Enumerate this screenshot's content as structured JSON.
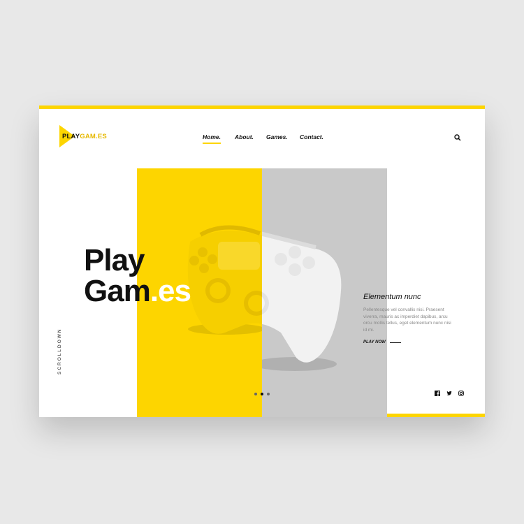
{
  "brand": {
    "logo_part1": "PLAY",
    "logo_part2": "GAM.ES",
    "accent": "#fdd500",
    "secondary": "#c9c9c9"
  },
  "nav": {
    "items": [
      "Home.",
      "About.",
      "Games.",
      "Contact."
    ],
    "active": "Home."
  },
  "hero": {
    "line1": "Play",
    "line2_main": "Gam",
    "line2_accent": ".es"
  },
  "side": {
    "title": "Elementum nunc",
    "body": "Pellentesque vel convallis nisi. Praesent viverra, mauris ac imperdiet dapibus, arcu orcu mollis tellus, eget elementum nunc nisi id mi.",
    "cta": "PLAY NOW"
  },
  "scroll_label": "SCROLLDOWN",
  "carousel": {
    "count": 3,
    "active_index": 1
  },
  "icons": [
    "search-icon",
    "facebook-icon",
    "twitter-icon",
    "instagram-icon"
  ]
}
